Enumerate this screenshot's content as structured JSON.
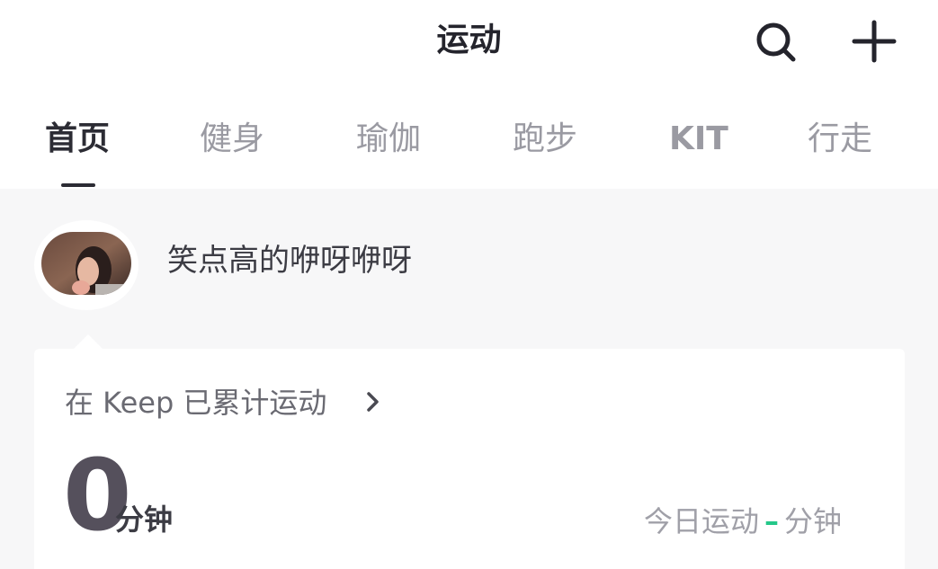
{
  "header": {
    "title": "运动",
    "search_icon": "search-icon",
    "add_icon": "plus-icon"
  },
  "tabs": [
    {
      "label": "首页",
      "active": true
    },
    {
      "label": "健身",
      "active": false
    },
    {
      "label": "瑜伽",
      "active": false
    },
    {
      "label": "跑步",
      "active": false
    },
    {
      "label": "KIT",
      "active": false
    },
    {
      "label": "行走",
      "active": false
    }
  ],
  "profile": {
    "username": "笑点高的咿呀咿呀",
    "avatar": "avatar-photo"
  },
  "summary": {
    "title": "在 Keep 已累计运动",
    "total_minutes": "0",
    "unit": "分钟",
    "today_label": "今日运动",
    "today_value": "–",
    "today_unit": "分钟"
  },
  "colors": {
    "accent": "#24c789",
    "text_primary": "#2c2c34",
    "text_muted": "#9a9aa2",
    "background": "#f7f7f8"
  }
}
